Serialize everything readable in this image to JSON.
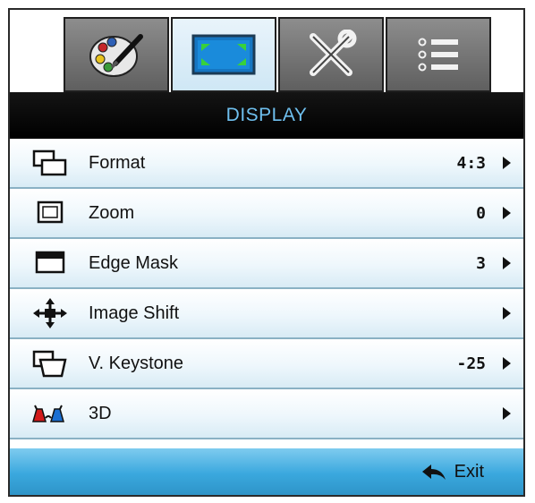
{
  "tabs": [
    {
      "icon": "palette-icon",
      "active": false
    },
    {
      "icon": "display-screen-icon",
      "active": true
    },
    {
      "icon": "tools-icon",
      "active": false
    },
    {
      "icon": "list-options-icon",
      "active": false
    }
  ],
  "menu": {
    "title": "DISPLAY",
    "items": [
      {
        "label": "Format",
        "value": "4:3",
        "icon": "format-icon"
      },
      {
        "label": "Zoom",
        "value": "0",
        "icon": "zoom-icon"
      },
      {
        "label": "Edge Mask",
        "value": "3",
        "icon": "edge-mask-icon"
      },
      {
        "label": "Image Shift",
        "value": "",
        "icon": "image-shift-icon"
      },
      {
        "label": "V. Keystone",
        "value": "-25",
        "icon": "keystone-icon"
      },
      {
        "label": "3D",
        "value": "",
        "icon": "3d-glasses-icon"
      }
    ]
  },
  "footer": {
    "exit_label": "Exit"
  },
  "colors": {
    "header_text": "#6fc0ef",
    "footer_blue": "#3aa8de",
    "row_divider": "#8ab1c4"
  }
}
